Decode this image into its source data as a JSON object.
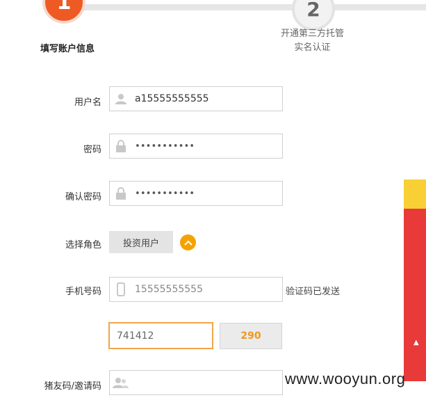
{
  "steps": [
    {
      "number": "1",
      "label": "填写账户信息"
    },
    {
      "number": "2",
      "label_line1": "开通第三方托管",
      "label_line2": "实名认证"
    }
  ],
  "form": {
    "username": {
      "label": "用户名",
      "value": "a15555555555",
      "icon": "user-icon"
    },
    "password": {
      "label": "密码",
      "value": "•••••••••••",
      "icon": "lock-icon"
    },
    "confirm_password": {
      "label": "确认密码",
      "value": "•••••••••••",
      "icon": "lock-icon"
    },
    "role": {
      "label": "选择角色",
      "selected": "投资用户",
      "toggle_icon": "chevron-up-icon"
    },
    "phone": {
      "label": "手机号码",
      "value": "15555555555",
      "icon": "phone-icon",
      "hint": "验证码已发送"
    },
    "sms_code": {
      "value": "741412",
      "countdown": "290"
    },
    "invite": {
      "label": "猪友码/邀请码",
      "icon": "users-icon"
    }
  },
  "watermark": "www.wooyun.org",
  "colors": {
    "accent": "#ee5a24",
    "countdown": "#f1971d",
    "toggle": "#f5a201",
    "side_red": "#e93a3a",
    "side_yellow": "#f8d035"
  }
}
